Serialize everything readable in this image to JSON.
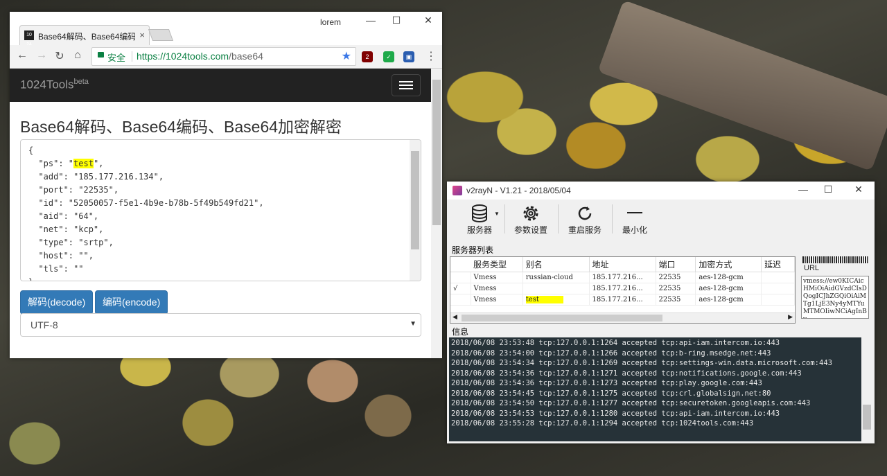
{
  "chrome": {
    "tab_title": "Base64解码、Base64编码",
    "tab_favicon": "10 24",
    "profile": "lorem",
    "security_label": "安全",
    "url_host": "https://1024tools.com",
    "url_path": "/base64",
    "extension_badge": "2",
    "page": {
      "brand": "1024Tools",
      "brand_sup": "beta",
      "heading": "Base64解码、Base64编码、Base64加密解密",
      "textarea_lines": [
        "{",
        "  \"ps\": \"",
        "test",
        "\",",
        "  \"add\": \"185.177.216.134\",",
        "  \"port\": \"22535\",",
        "  \"id\": \"52050057-f5e1-4b9e-b78b-5f49b549fd21\",",
        "  \"aid\": \"64\",",
        "  \"net\": \"kcp\",",
        "  \"type\": \"srtp\",",
        "  \"host\": \"\",",
        "  \"tls\": \"\"",
        "}"
      ],
      "decode_label": "解码(decode)",
      "encode_label": "编码(encode)",
      "charset": "UTF-8"
    }
  },
  "v2ray": {
    "title": "v2rayN - V1.21 - 2018/05/04",
    "toolbar": {
      "servers": "服务器",
      "settings": "参数设置",
      "restart": "重启服务",
      "minimize": "最小化"
    },
    "server_list_label": "服务器列表",
    "columns": [
      "服务类型",
      "别名",
      "地址",
      "端口",
      "加密方式",
      "延迟"
    ],
    "rows": [
      {
        "check": "",
        "type": "Vmess",
        "alias": "russian-cloud",
        "address": "185.177.216...",
        "port": "22535",
        "security": "aes-128-gcm",
        "latency": ""
      },
      {
        "check": "√",
        "type": "Vmess",
        "alias": "",
        "address": "185.177.216...",
        "port": "22535",
        "security": "aes-128-gcm",
        "latency": ""
      },
      {
        "check": "",
        "type": "Vmess",
        "alias": "test",
        "address": "185.177.216...",
        "port": "22535",
        "security": "aes-128-gcm",
        "latency": ""
      }
    ],
    "url_label": "URL",
    "url_text": "vmess://ew0KICAicHMiOiAidGVzdCIsDQogICJhZGQiOiAiMTg1LjE3Ny4yMTYuMTMOIiwNCiAgInBv",
    "info_label": "信息",
    "log": [
      "2018/06/08 23:53:48 tcp:127.0.0.1:1264 accepted tcp:api-iam.intercom.io:443",
      "2018/06/08 23:54:00 tcp:127.0.0.1:1266 accepted tcp:b-ring.msedge.net:443",
      "2018/06/08 23:54:34 tcp:127.0.0.1:1269 accepted tcp:settings-win.data.microsoft.com:443",
      "2018/06/08 23:54:36 tcp:127.0.0.1:1271 accepted tcp:notifications.google.com:443",
      "2018/06/08 23:54:36 tcp:127.0.0.1:1273 accepted tcp:play.google.com:443",
      "2018/06/08 23:54:45 tcp:127.0.0.1:1275 accepted tcp:crl.globalsign.net:80",
      "2018/06/08 23:54:50 tcp:127.0.0.1:1277 accepted tcp:securetoken.googleapis.com:443",
      "2018/06/08 23:54:53 tcp:127.0.0.1:1280 accepted tcp:api-iam.intercom.io:443",
      "2018/06/08 23:55:28 tcp:127.0.0.1:1294 accepted tcp:1024tools.com:443"
    ]
  },
  "colors": {
    "highlight": "#ffff00",
    "bootstrap_primary": "#337ab7",
    "secure_green": "#0b8043",
    "console_bg": "#263238"
  }
}
